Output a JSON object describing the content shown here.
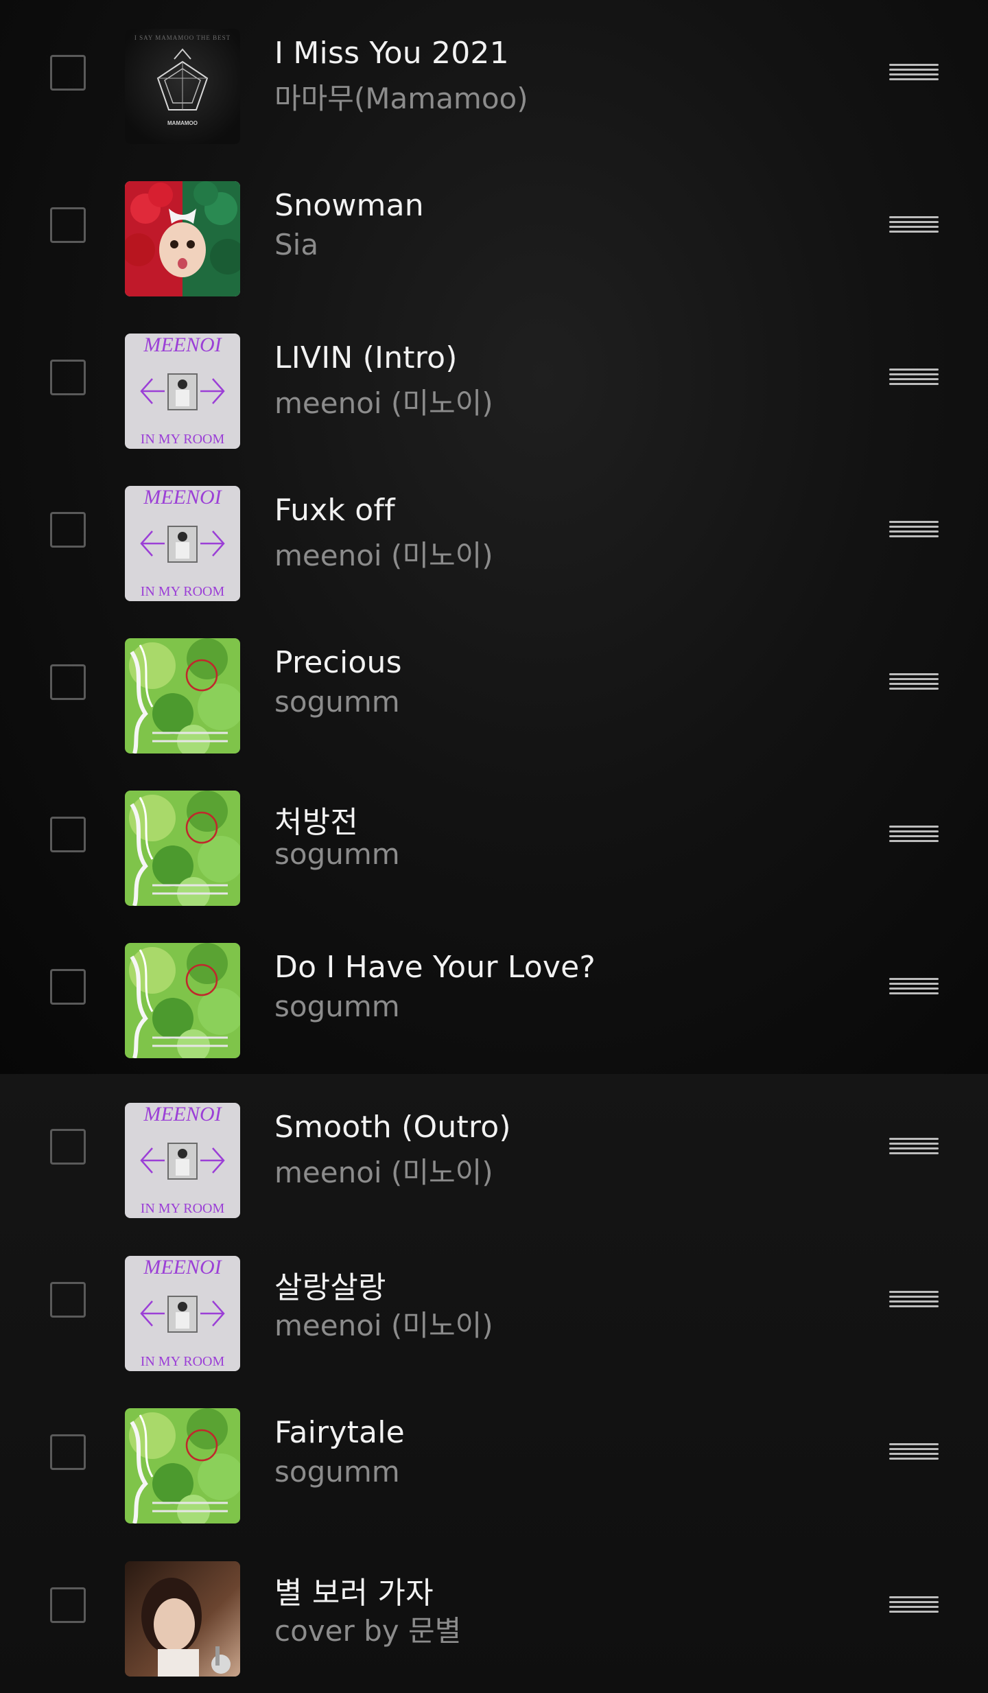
{
  "tracks": [
    {
      "title": "I Miss You 2021",
      "artist": "마마무(Mamamoo)",
      "art": "mamamoo-album-art",
      "art_text": "I SAY MAMAMOO THE BEST",
      "art_logo": "MAMAMOO"
    },
    {
      "title": "Snowman",
      "artist": "Sia",
      "art": "sia-album-art"
    },
    {
      "title": "LIVIN (Intro)",
      "artist": "meenoi (미노이)",
      "art": "meenoi-album-art",
      "art_text_top": "MEENOI",
      "art_text_bottom": "IN MY ROOM"
    },
    {
      "title": "Fuxk off",
      "artist": "meenoi (미노이)",
      "art": "meenoi-album-art",
      "art_text_top": "MEENOI",
      "art_text_bottom": "IN MY ROOM"
    },
    {
      "title": "Precious",
      "artist": "sogumm",
      "art": "sogumm-album-art"
    },
    {
      "title": "처방전",
      "artist": "sogumm",
      "art": "sogumm-album-art"
    },
    {
      "title": "Do I Have Your Love?",
      "artist": "sogumm",
      "art": "sogumm-album-art"
    },
    {
      "title": "Smooth (Outro)",
      "artist": "meenoi (미노이)",
      "art": "meenoi-album-art",
      "art_text_top": "MEENOI",
      "art_text_bottom": "IN MY ROOM"
    },
    {
      "title": "살랑살랑",
      "artist": "meenoi (미노이)",
      "art": "meenoi-album-art",
      "art_text_top": "MEENOI",
      "art_text_bottom": "IN MY ROOM"
    },
    {
      "title": "Fairytale",
      "artist": "sogumm",
      "art": "sogumm-album-art"
    },
    {
      "title": "별 보러 가자",
      "artist": "cover by 문별",
      "art": "moonbyul-album-art"
    }
  ],
  "colors": {
    "background": "#0b0b0b",
    "title_text": "#f2f2f2",
    "artist_text": "#8c8c8c",
    "checkbox_border": "#5a5a5a",
    "handle": "#bdbdbd",
    "meenoi_purple": "#9b3fd6",
    "sogumm_green": "#6fbf3a"
  },
  "icons": {
    "checkbox": "checkbox-unchecked-icon",
    "handle": "drag-handle-icon"
  }
}
